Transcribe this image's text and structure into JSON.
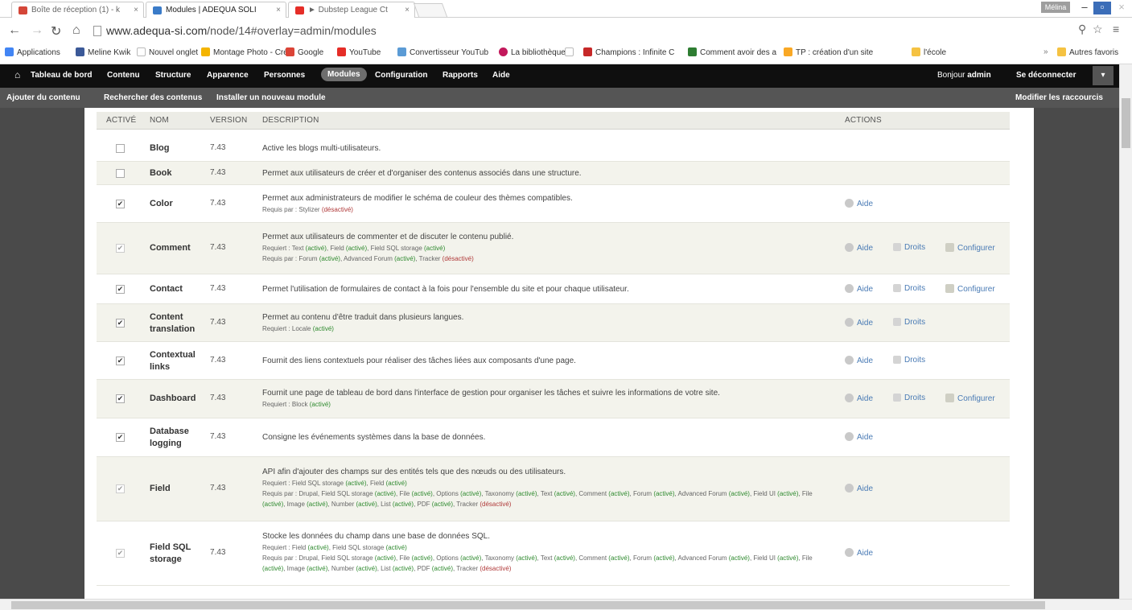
{
  "browser": {
    "tabs": [
      {
        "label": "Boîte de réception (1) - k",
        "favicon_color": "#d44638"
      },
      {
        "label": "Modules | ADEQUA SOLI",
        "favicon_color": "#3a7bc8"
      },
      {
        "label": "► Dubstep League Ct",
        "favicon_color": "#e52d27"
      }
    ],
    "window_user": "Mélina",
    "url_host": "www.adequa-si.com",
    "url_path": "/node/14#overlay=admin/modules",
    "bookmarks": [
      {
        "label": "Applications",
        "color": "#4285f4"
      },
      {
        "label": "Meline Kwik",
        "color": "#3b5998"
      },
      {
        "label": "Nouvel onglet",
        "color": "#bbbbbb"
      },
      {
        "label": "Montage Photo - Cré",
        "color": "#f4b400"
      },
      {
        "label": "Google",
        "color": "#db4437"
      },
      {
        "label": "YouTube",
        "color": "#e52d27"
      },
      {
        "label": "Convertisseur YouTub",
        "color": "#5b9bd5"
      },
      {
        "label": "La bibliothèque",
        "color": "#c2185b"
      },
      {
        "label": "",
        "color": "#bbbbbb"
      },
      {
        "label": "Champions : Infinite C",
        "color": "#c62828"
      },
      {
        "label": "Comment avoir des a",
        "color": "#2e7d32"
      },
      {
        "label": "TP : création d'un site",
        "color": "#f9a825"
      },
      {
        "label": "l'école",
        "color": "#f5c242"
      }
    ],
    "other_bookmarks": "Autres favoris"
  },
  "admin_toolbar": {
    "items": [
      "Tableau de bord",
      "Contenu",
      "Structure",
      "Apparence",
      "Personnes",
      "Modules",
      "Configuration",
      "Rapports",
      "Aide"
    ],
    "active": "Modules",
    "greeting_prefix": "Bonjour",
    "greeting_user": "admin",
    "logout": "Se déconnecter"
  },
  "shortcuts": {
    "items": [
      "Ajouter du contenu",
      "Rechercher des contenus",
      "Installer un nouveau module"
    ],
    "edit": "Modifier les raccourcis"
  },
  "table": {
    "headers": {
      "enabled": "ACTIVÉ",
      "name": "NOM",
      "version": "VERSION",
      "description": "DESCRIPTION",
      "actions": "ACTIONS"
    },
    "action_labels": {
      "help": "Aide",
      "perms": "Droits",
      "config": "Configurer"
    },
    "rows": [
      {
        "name": "Blog",
        "version": "7.43",
        "checked": false,
        "disabled": false,
        "description": "Active les blogs multi-utilisateurs.",
        "requires": "",
        "required_by": "",
        "actions": []
      },
      {
        "name": "Book",
        "version": "7.43",
        "checked": false,
        "disabled": false,
        "description": "Permet aux utilisateurs de créer et d'organiser des contenus associés dans une structure.",
        "requires": "",
        "required_by": "",
        "actions": []
      },
      {
        "name": "Color",
        "version": "7.43",
        "checked": true,
        "disabled": false,
        "description": "Permet aux administrateurs de modifier le schéma de couleur des thèmes compatibles.",
        "requires": "",
        "required_by": "Requis par : Stylizer (désactivé)",
        "actions": [
          "help"
        ]
      },
      {
        "name": "Comment",
        "version": "7.43",
        "checked": true,
        "disabled": true,
        "description": "Permet aux utilisateurs de commenter et de discuter le contenu publié.",
        "requires": "Requiert : Text (activé), Field (activé), Field SQL storage (activé)",
        "required_by": "Requis par : Forum (activé), Advanced Forum (activé), Tracker (désactivé)",
        "actions": [
          "help",
          "perms",
          "config"
        ]
      },
      {
        "name": "Contact",
        "version": "7.43",
        "checked": true,
        "disabled": false,
        "description": "Permet l'utilisation de formulaires de contact à la fois pour l'ensemble du site et pour chaque utilisateur.",
        "requires": "",
        "required_by": "",
        "actions": [
          "help",
          "perms",
          "config"
        ]
      },
      {
        "name": "Content translation",
        "version": "7.43",
        "checked": true,
        "disabled": false,
        "description": "Permet au contenu d'être traduit dans plusieurs langues.",
        "requires": "Requiert : Locale (activé)",
        "required_by": "",
        "actions": [
          "help",
          "perms"
        ]
      },
      {
        "name": "Contextual links",
        "version": "7.43",
        "checked": true,
        "disabled": false,
        "description": "Fournit des liens contextuels pour réaliser des tâches liées aux composants d'une page.",
        "requires": "",
        "required_by": "",
        "actions": [
          "help",
          "perms"
        ]
      },
      {
        "name": "Dashboard",
        "version": "7.43",
        "checked": true,
        "disabled": false,
        "description": "Fournit une page de tableau de bord dans l'interface de gestion pour organiser les tâches et suivre les informations de votre site.",
        "requires": "Requiert : Block (activé)",
        "required_by": "",
        "actions": [
          "help",
          "perms",
          "config"
        ]
      },
      {
        "name": "Database logging",
        "version": "7.43",
        "checked": true,
        "disabled": false,
        "description": "Consigne les événements systèmes dans la base de données.",
        "requires": "",
        "required_by": "",
        "actions": [
          "help"
        ]
      },
      {
        "name": "Field",
        "version": "7.43",
        "checked": true,
        "disabled": true,
        "description": "API afin d'ajouter des champs sur des entités tels que des nœuds ou des utilisateurs.",
        "requires": "Requiert : Field SQL storage (activé), Field (activé)",
        "required_by": "Requis par : Drupal, Field SQL storage (activé), File (activé), Options (activé), Taxonomy (activé), Text (activé), Comment (activé), Forum (activé), Advanced Forum (activé), Field UI (activé), File (activé), Image (activé), Number (activé), List (activé), PDF (activé), Tracker (désactivé)",
        "actions": [
          "help"
        ]
      },
      {
        "name": "Field SQL storage",
        "version": "7.43",
        "checked": true,
        "disabled": true,
        "description": "Stocke les données du champ dans une base de données SQL.",
        "requires": "Requiert : Field (activé), Field SQL storage (activé)",
        "required_by": "Requis par : Drupal, Field SQL storage (activé), File (activé), Options (activé), Taxonomy (activé), Text (activé), Comment (activé), Forum (activé), Advanced Forum (activé), Field UI (activé), File (activé), Image (activé), Number (activé), List (activé), PDF (activé), Tracker (désactivé)",
        "actions": [
          "help"
        ]
      }
    ]
  },
  "colors": {
    "toolbar_bg": "#0f0f0f",
    "shortcut_bg": "#555555",
    "overlay_bg": "#4a4a4a",
    "link": "#4a7bb5",
    "enabled": "#2f8a2f",
    "disabled": "#b03a3a"
  }
}
